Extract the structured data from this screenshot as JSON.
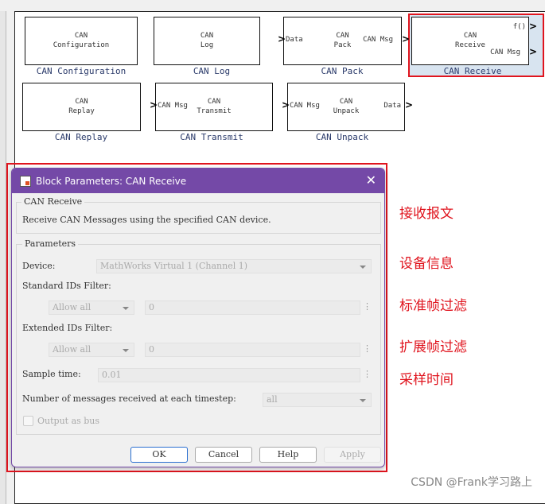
{
  "blocks": [
    {
      "label": "CAN Configuration",
      "text1": "CAN",
      "text2": "Configuration"
    },
    {
      "label": "CAN Log",
      "text1": "CAN",
      "text2": "Log"
    },
    {
      "label": "CAN Pack",
      "text1": "CAN",
      "text2": "Pack",
      "in": "Data",
      "out": "CAN Msg"
    },
    {
      "label": "CAN Receive",
      "text1": "CAN",
      "text2": "Receive",
      "out1": "f()",
      "out2": "CAN Msg"
    },
    {
      "label": "CAN Replay",
      "text1": "CAN",
      "text2": "Replay"
    },
    {
      "label": "CAN Transmit",
      "text1": "CAN",
      "text2": "Transmit",
      "in": "CAN Msg"
    },
    {
      "label": "CAN Unpack",
      "text1": "CAN",
      "text2": "Unpack",
      "in": "CAN Msg",
      "out": "Data"
    }
  ],
  "dialog": {
    "title": "Block Parameters: CAN Receive",
    "section_title": "CAN Receive",
    "description": "Receive CAN Messages using the specified CAN device.",
    "params_title": "Parameters",
    "device_label": "Device:",
    "device_value": "MathWorks Virtual 1 (Channel 1)",
    "std_label": "Standard IDs Filter:",
    "std_mode": "Allow all",
    "std_value": "0",
    "ext_label": "Extended IDs Filter:",
    "ext_mode": "Allow all",
    "ext_value": "0",
    "sample_label": "Sample time:",
    "sample_value": "0.01",
    "nmsg_label": "Number of messages received at each timestep:",
    "nmsg_value": "all",
    "bus_label": "Output as bus",
    "ok": "OK",
    "cancel": "Cancel",
    "help": "Help",
    "apply": "Apply"
  },
  "annotations": [
    "接收报文",
    "设备信息",
    "标准帧过滤",
    "扩展帧过滤",
    "采样时间"
  ],
  "watermark": "CSDN @Frank学习路上"
}
